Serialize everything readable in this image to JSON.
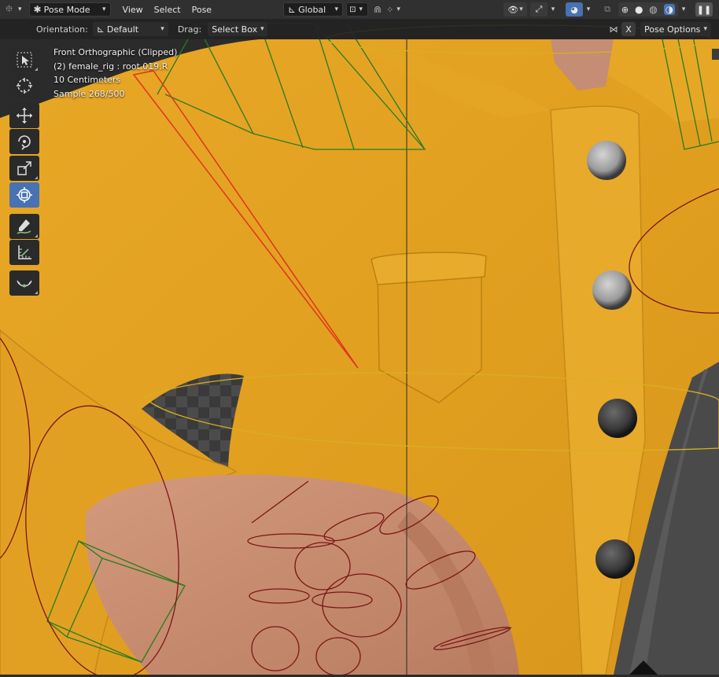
{
  "header": {
    "mode_label": "Pose Mode",
    "menus": [
      "View",
      "Select",
      "Pose"
    ],
    "transform_orientation": "Global"
  },
  "tool_settings": {
    "orientation_label": "Orientation:",
    "orientation_value": "Default",
    "drag_label": "Drag:",
    "drag_value": "Select Box",
    "x_label": "X",
    "pose_options_label": "Pose Options"
  },
  "viewport_info": {
    "view_name": "Front Orthographic (Clipped)",
    "object_bone": "(2) female_rig : root.019.R",
    "scale": "10 Centimeters",
    "sample": "Sample 268/500"
  },
  "toolbar": [
    "select-box",
    "cursor",
    "move",
    "rotate",
    "scale",
    "transform",
    "annotate",
    "measure",
    "relax-pose"
  ],
  "colors": {
    "header_bg": "#303030",
    "active_tool": "#4772b3",
    "sweater": "#e2a021",
    "skin": "#c98f72",
    "bone_green": "#2a7a1f",
    "bone_red": "#e0341c",
    "widget_yellow": "#d8b020",
    "widget_darkred": "#7a1616"
  }
}
